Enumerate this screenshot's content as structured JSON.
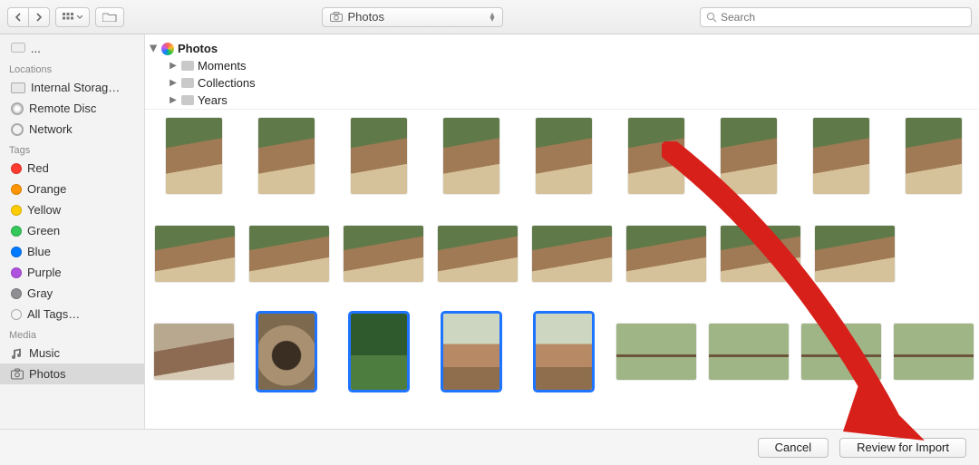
{
  "toolbar": {
    "location_title": "Photos",
    "search_placeholder": "Search"
  },
  "sidebar": {
    "truncated_top_item": "...",
    "sections": [
      {
        "header": "Locations",
        "items": [
          {
            "icon": "internal-storage",
            "label": "Internal Storag…"
          },
          {
            "icon": "disc",
            "label": "Remote Disc"
          },
          {
            "icon": "network",
            "label": "Network"
          }
        ]
      },
      {
        "header": "Tags",
        "items": [
          {
            "icon": "tag",
            "color": "#ff3b30",
            "label": "Red"
          },
          {
            "icon": "tag",
            "color": "#ff9500",
            "label": "Orange"
          },
          {
            "icon": "tag",
            "color": "#ffcc00",
            "label": "Yellow"
          },
          {
            "icon": "tag",
            "color": "#34c759",
            "label": "Green"
          },
          {
            "icon": "tag",
            "color": "#007aff",
            "label": "Blue"
          },
          {
            "icon": "tag",
            "color": "#af52de",
            "label": "Purple"
          },
          {
            "icon": "tag",
            "color": "#8e8e93",
            "label": "Gray"
          },
          {
            "icon": "all-tags",
            "label": "All Tags…"
          }
        ]
      },
      {
        "header": "Media",
        "items": [
          {
            "icon": "music",
            "label": "Music"
          },
          {
            "icon": "photos",
            "label": "Photos",
            "selected": true
          }
        ]
      }
    ]
  },
  "source_list": {
    "root": "Photos",
    "children": [
      "Moments",
      "Collections",
      "Years"
    ]
  },
  "thumbnails": {
    "rows": [
      {
        "count": 9,
        "shape": "portrait",
        "style": "ppl",
        "selected": []
      },
      {
        "count": 8,
        "shape": "land",
        "style": "ppl",
        "selected": []
      },
      {
        "count": 9,
        "shape": "mixed",
        "style": "mixed",
        "selected": [
          1,
          2,
          3,
          4
        ]
      }
    ]
  },
  "footer": {
    "cancel": "Cancel",
    "confirm": "Review for Import"
  }
}
